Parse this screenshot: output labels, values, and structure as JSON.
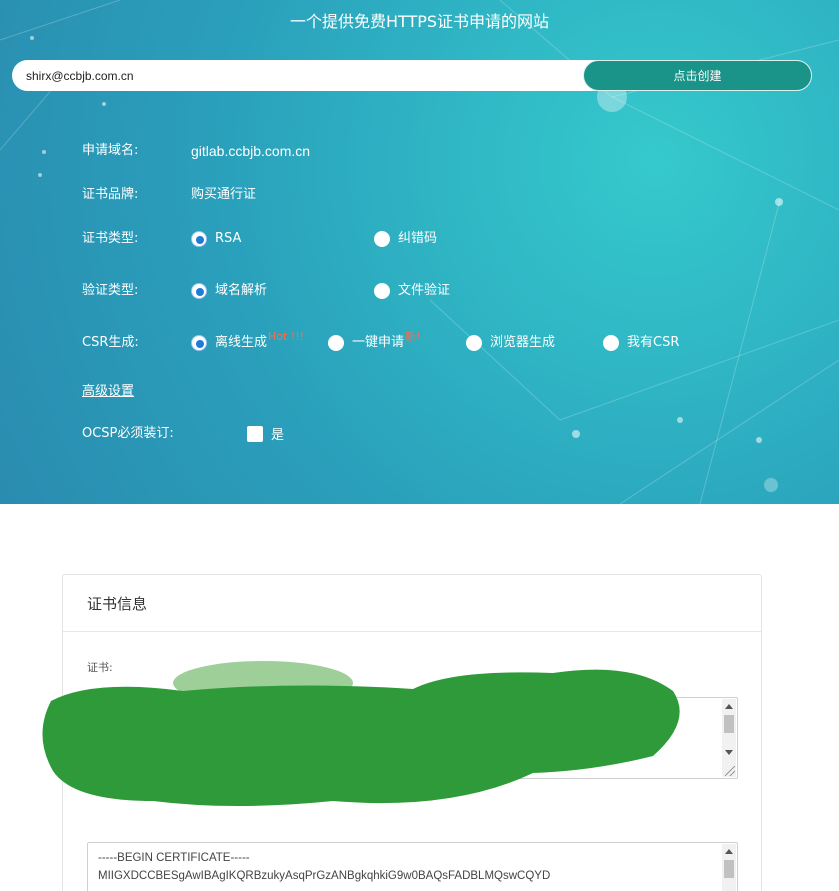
{
  "header": {
    "title": "一个提供免费HTTPS证书申请的网站"
  },
  "email": {
    "value": "shirx@ccbjb.com.cn",
    "placeholder": ""
  },
  "create_button": {
    "label": "点击创建"
  },
  "form": {
    "domain": {
      "label": "申请域名:",
      "value": "gitlab.ccbjb.com.cn"
    },
    "brand": {
      "label": "证书品牌:",
      "value": "购买通行证"
    },
    "cert_type": {
      "label": "证书类型:",
      "options": [
        "RSA",
        "纠错码"
      ],
      "selected": "RSA"
    },
    "verify_type": {
      "label": "验证类型:",
      "options": [
        "域名解析",
        "文件验证"
      ],
      "selected": "域名解析"
    },
    "csr": {
      "label": "CSR生成:",
      "options": [
        {
          "label": "离线生成",
          "badge": "Hot !!!"
        },
        {
          "label": "一键申请",
          "badge": "新!"
        },
        {
          "label": "浏览器生成",
          "badge": ""
        },
        {
          "label": "我有CSR",
          "badge": ""
        }
      ],
      "selected": "离线生成"
    },
    "advanced_link": "高级设置",
    "ocsp": {
      "label": "OCSP必须装订:",
      "checkbox_label": "是",
      "checked": false
    }
  },
  "cert_panel": {
    "title": "证书信息",
    "cert_label": "证书:",
    "cert_text_line1": "-----BEGIN CERTIFICATE-----",
    "cert_text_line2": "MIIGXDCCBESgAwIBAgIKQRBzukyAsqPrGzANBgkqhkiG9w0BAQsFADBLMQswCQYD"
  },
  "colors": {
    "accent": "#1a9488",
    "radio_on": "#1e7bd8",
    "badge": "#ff6a4a",
    "redaction": "#2f9a3a"
  }
}
